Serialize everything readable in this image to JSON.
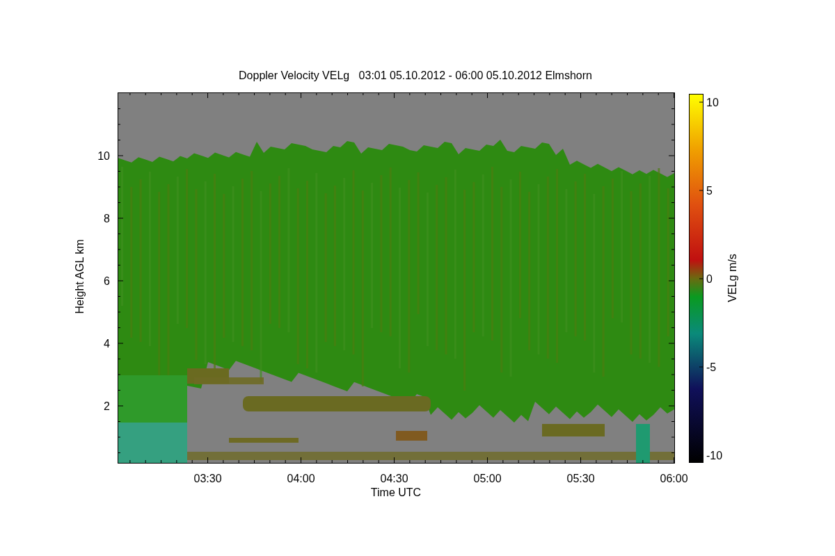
{
  "title": "Doppler Velocity VELg   03:01 05.10.2012 - 06:00 05.10.2012 Elmshorn",
  "y_axis": {
    "label": "Height AGL km",
    "ticks": [
      "10",
      "8",
      "6",
      "4",
      "2"
    ]
  },
  "x_axis": {
    "label": "Time UTC",
    "ticks": [
      "03:30",
      "04:00",
      "04:30",
      "05:00",
      "05:30",
      "06:00"
    ]
  },
  "colorbar": {
    "label": "VELg m/s",
    "ticks": [
      "10",
      "5",
      "0",
      "-5",
      "-10"
    ]
  }
}
